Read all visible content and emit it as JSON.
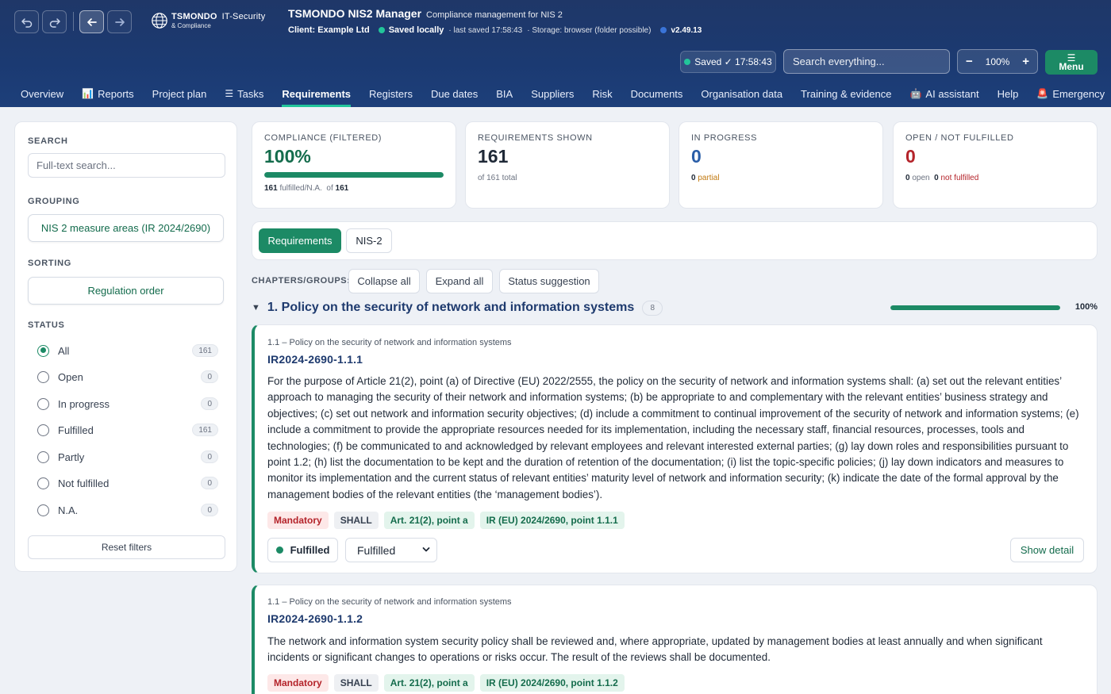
{
  "header": {
    "logo_main": "TSMONDO",
    "logo_suffix": "IT-Security",
    "logo_sub": "& Compliance",
    "app_title": "TSMONDO NIS2 Manager",
    "app_subtitle": "Compliance management for NIS 2",
    "client": "Client: Example Ltd",
    "saved_status": "Saved locally",
    "last_saved": "· last saved 17:58:43",
    "storage": "· Storage: browser (folder possible)",
    "version": "v2.49.13",
    "saved_badge": "Saved ✓ 17:58:43",
    "search_placeholder": "Search everything...",
    "zoom_minus": "−",
    "zoom_level": "100%",
    "zoom_plus": "+",
    "menu_icon": "☰",
    "menu_label": "Menu"
  },
  "nav": [
    {
      "label": "Overview"
    },
    {
      "label": "Reports",
      "icon": "📊"
    },
    {
      "label": "Project plan"
    },
    {
      "label": "Tasks",
      "icon": "☰"
    },
    {
      "label": "Requirements"
    },
    {
      "label": "Registers"
    },
    {
      "label": "Due dates"
    },
    {
      "label": "BIA"
    },
    {
      "label": "Suppliers"
    },
    {
      "label": "Risk"
    },
    {
      "label": "Documents"
    },
    {
      "label": "Organisation data"
    },
    {
      "label": "Training & evidence"
    },
    {
      "label": "AI assistant",
      "icon": "🤖"
    },
    {
      "label": "Help"
    },
    {
      "label": "Emergency",
      "icon": "🚨"
    }
  ],
  "sidebar": {
    "search_label": "SEARCH",
    "search_placeholder": "Full-text search...",
    "grouping_label": "GROUPING",
    "grouping_value": "NIS 2 measure areas (IR 2024/2690)",
    "sorting_label": "SORTING",
    "sorting_value": "Regulation order",
    "status_label": "STATUS",
    "status_options": [
      {
        "label": "All",
        "count": "161",
        "selected": true
      },
      {
        "label": "Open",
        "count": "0"
      },
      {
        "label": "In progress",
        "count": "0"
      },
      {
        "label": "Fulfilled",
        "count": "161"
      },
      {
        "label": "Partly",
        "count": "0"
      },
      {
        "label": "Not fulfilled",
        "count": "0"
      },
      {
        "label": "N.A.",
        "count": "0"
      }
    ],
    "reset_label": "Reset filters"
  },
  "stats": {
    "compliance": {
      "title": "COMPLIANCE (FILTERED)",
      "value": "100%",
      "progress": 1.0,
      "fulfilled_count": "161",
      "fulfilled_text": "fulfilled/N.A.",
      "of_text": "of",
      "of_count": "161"
    },
    "shown": {
      "title": "REQUIREMENTS SHOWN",
      "value": "161",
      "sub": "of 161 total"
    },
    "in_progress": {
      "title": "IN PROGRESS",
      "value": "0",
      "partial_count": "0",
      "partial_text": "partial"
    },
    "open": {
      "title": "OPEN / NOT FULFILLED",
      "value": "0",
      "open_count": "0",
      "open_text": "open",
      "nf_count": "0",
      "nf_text": "not fulfilled"
    }
  },
  "tabs": [
    {
      "label": "Requirements"
    },
    {
      "label": "NIS-2"
    }
  ],
  "chapters": {
    "label": "CHAPTERS/GROUPS:",
    "collapse": "Collapse all",
    "expand": "Expand all",
    "suggestion": "Status suggestion"
  },
  "group": {
    "caret": "▼",
    "title": "1. Policy on the security of network and information systems",
    "count": "8",
    "progress": 1.0,
    "percent": "100%"
  },
  "requirements": [
    {
      "path": "1.1 – Policy on the security of network and information systems",
      "id": "IR2024-2690-1.1.1",
      "text": "For the purpose of Article 21(2), point (a) of Directive (EU) 2022/2555, the policy on the security of network and information systems shall: (a) set out the relevant entities’ approach to managing the security of their network and information systems; (b) be appropriate to and complementary with the relevant entities’ business strategy and objectives; (c) set out network and information security objectives; (d) include a commitment to continual improvement of the security of network and information systems; (e) include a commitment to provide the appropriate resources needed for its implementation, including the necessary staff, financial resources, processes, tools and technologies; (f) be communicated to and acknowledged by relevant employees and relevant interested external parties; (g) lay down roles and responsibilities pursuant to point 1.2; (h) list the documentation to be kept and the duration of retention of the documentation; (i) list the topic-specific policies; (j) lay down indicators and measures to monitor its implementation and the current status of relevant entities’ maturity level of network and information security; (k) indicate the date of the formal approval by the management bodies of the relevant entities (the ‘management bodies’).",
      "tags": {
        "mandatory": "Mandatory",
        "shall": "SHALL",
        "article": "Art. 21(2), point a",
        "ir": "IR (EU) 2024/2690, point 1.1.1"
      },
      "status": "Fulfilled",
      "status_select": "Fulfilled",
      "detail_label": "Show detail"
    },
    {
      "path": "1.1 – Policy on the security of network and information systems",
      "id": "IR2024-2690-1.1.2",
      "text": "The network and information system security policy shall be reviewed and, where appropriate, updated by management bodies at least annually and when significant incidents or significant changes to operations or risks occur. The result of the reviews shall be documented.",
      "tags": {
        "mandatory": "Mandatory",
        "shall": "SHALL",
        "article": "Art. 21(2), point a",
        "ir": "IR (EU) 2024/2690, point 1.1.2"
      }
    }
  ],
  "colors": {
    "brand_green": "#1c8a65",
    "header_blue": "#1b3a72",
    "danger": "#b4232a",
    "info_blue": "#2a5ea8"
  }
}
